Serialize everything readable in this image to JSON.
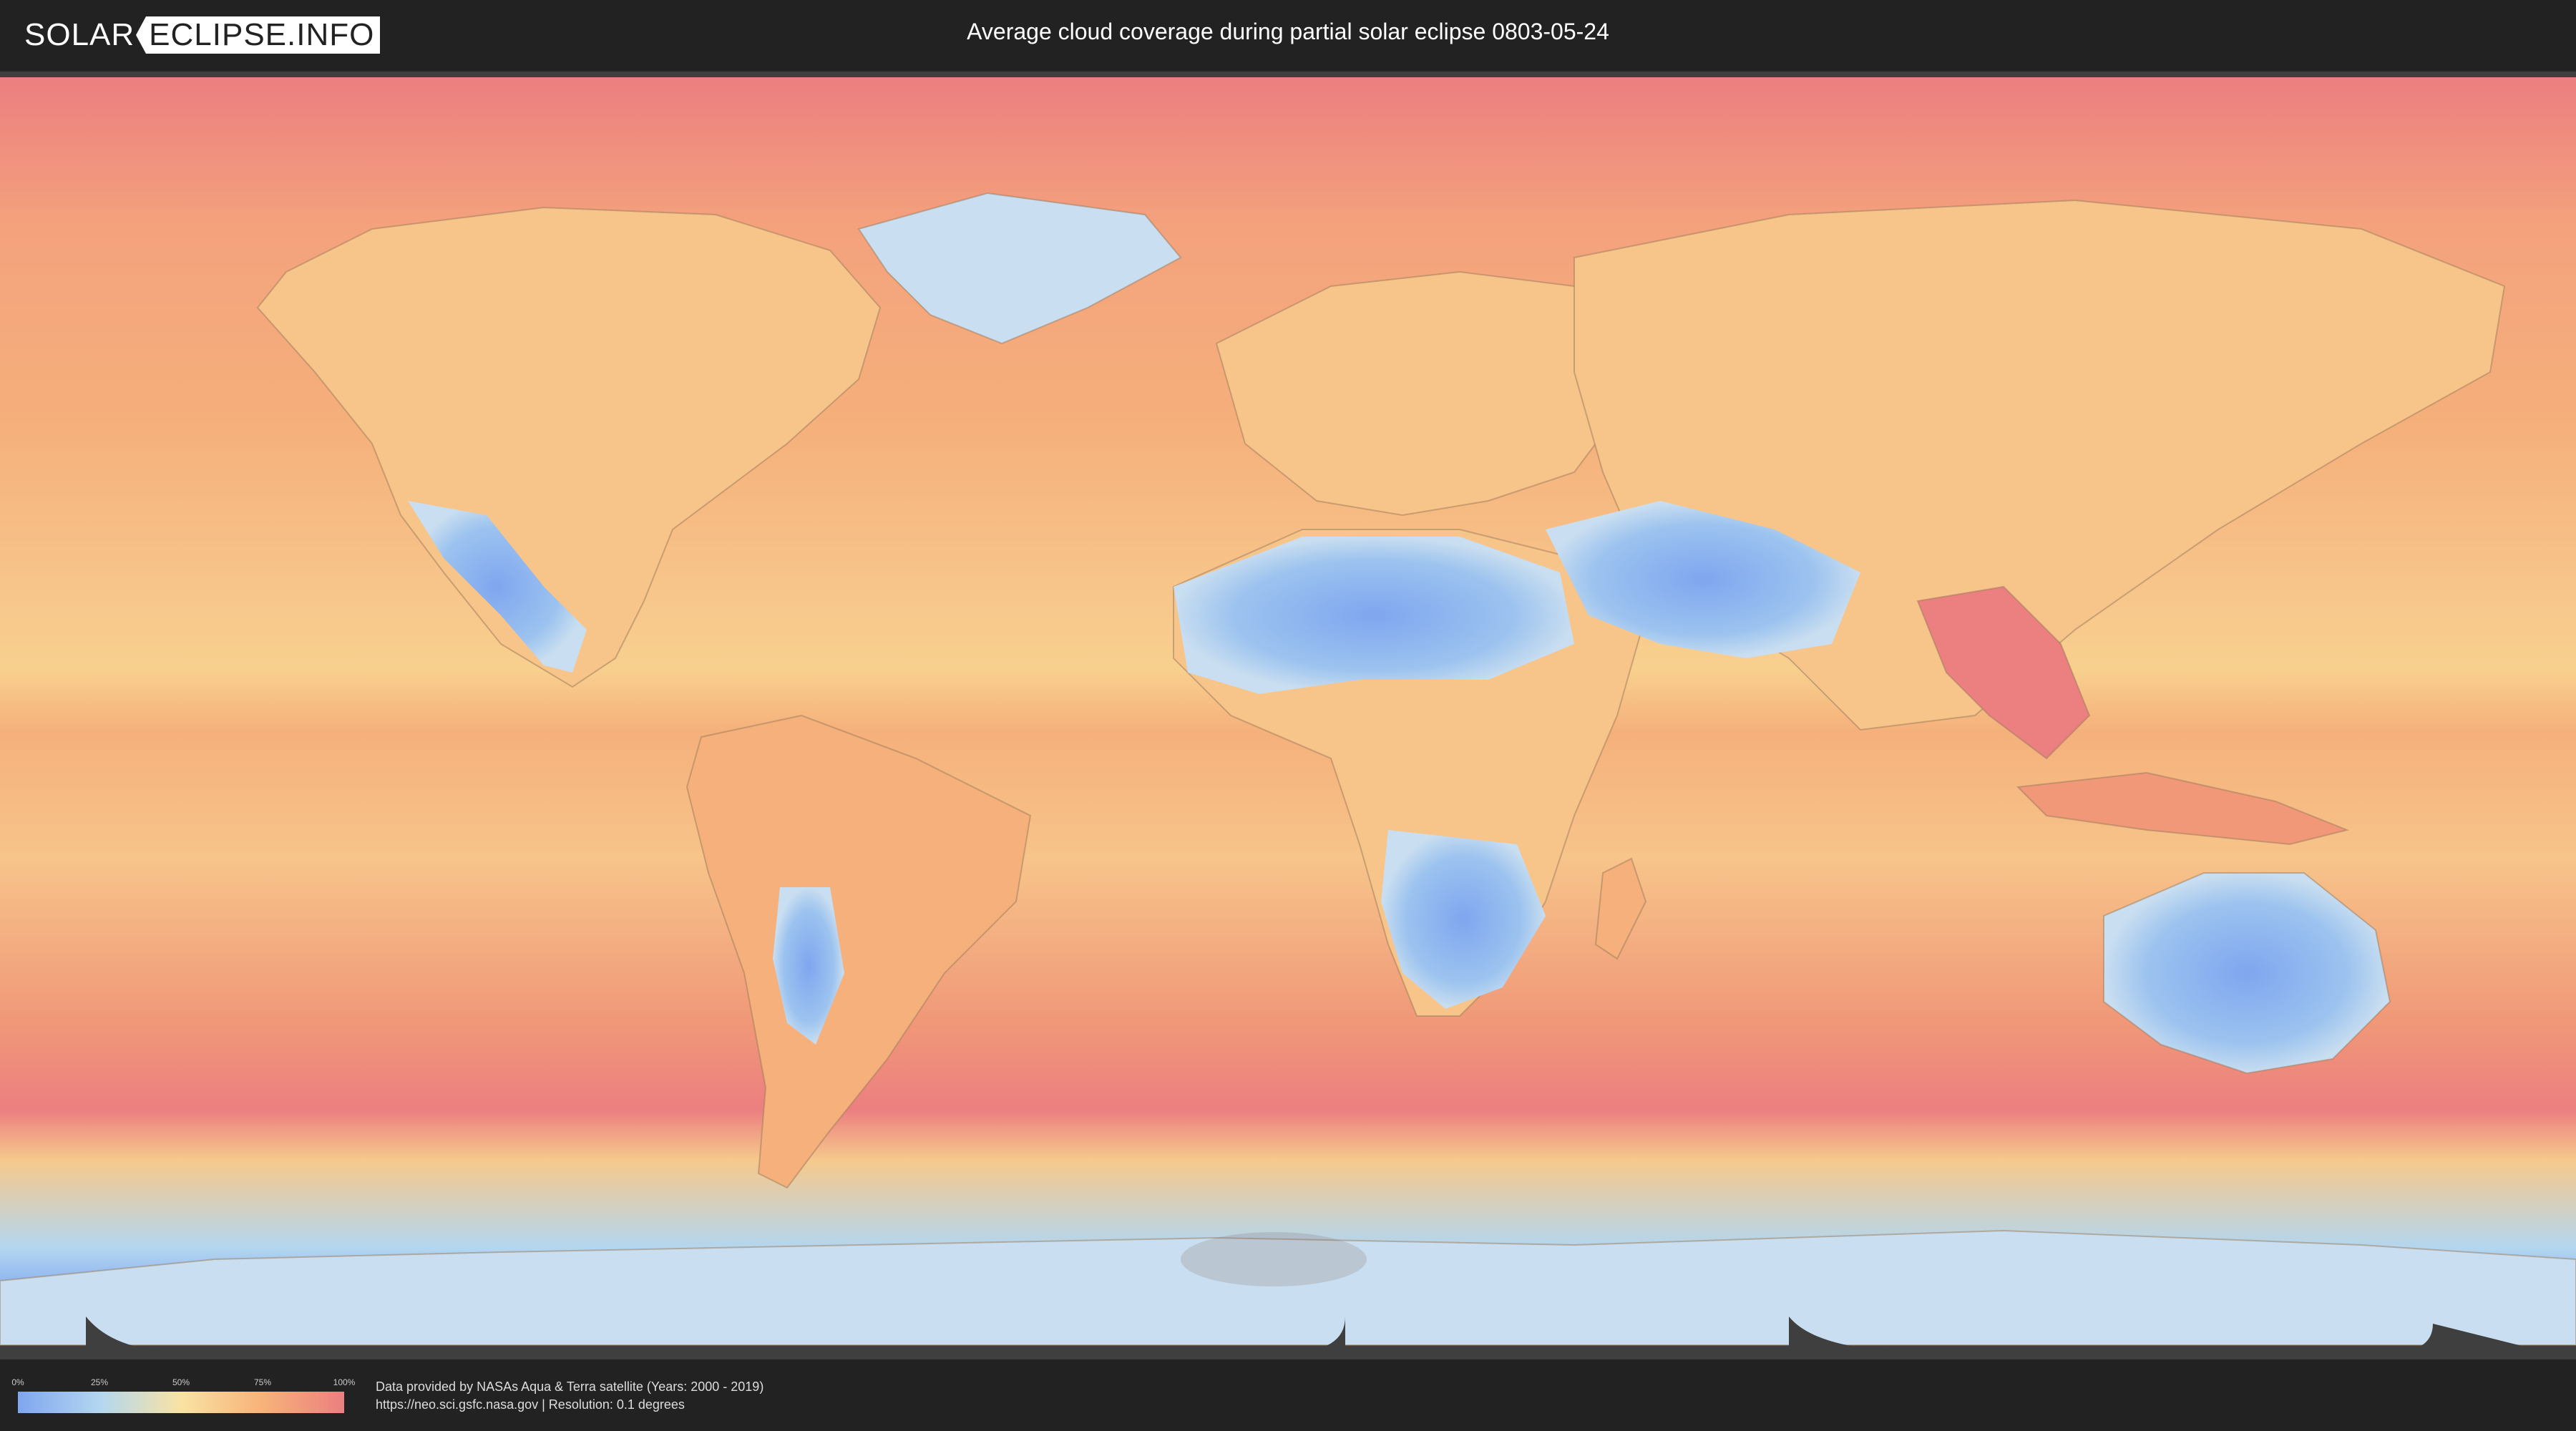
{
  "header": {
    "logo_left": "SOLAR",
    "logo_right": "ECLIPSE.INFO",
    "title": "Average cloud coverage during partial solar eclipse 0803-05-24"
  },
  "map": {
    "description_layer": "cloud-coverage-heatmap",
    "colors": {
      "ocean_high": "#ec7f80",
      "ocean_mid": "#f7b279",
      "land_mid": "#f9e3a4",
      "dry_low": "#b3d6f0",
      "very_low": "#7fa6ef",
      "no_data": "#3f3f3f"
    }
  },
  "legend": {
    "ticks": [
      "0%",
      "25%",
      "50%",
      "75%",
      "100%"
    ],
    "tick_fractions": [
      0,
      0.25,
      0.5,
      0.75,
      1
    ]
  },
  "credits": {
    "line1": "Data provided by NASAs Aqua & Terra satellite (Years: 2000 - 2019)",
    "line2": "https://neo.sci.gsfc.nasa.gov | Resolution: 0.1 degrees"
  }
}
